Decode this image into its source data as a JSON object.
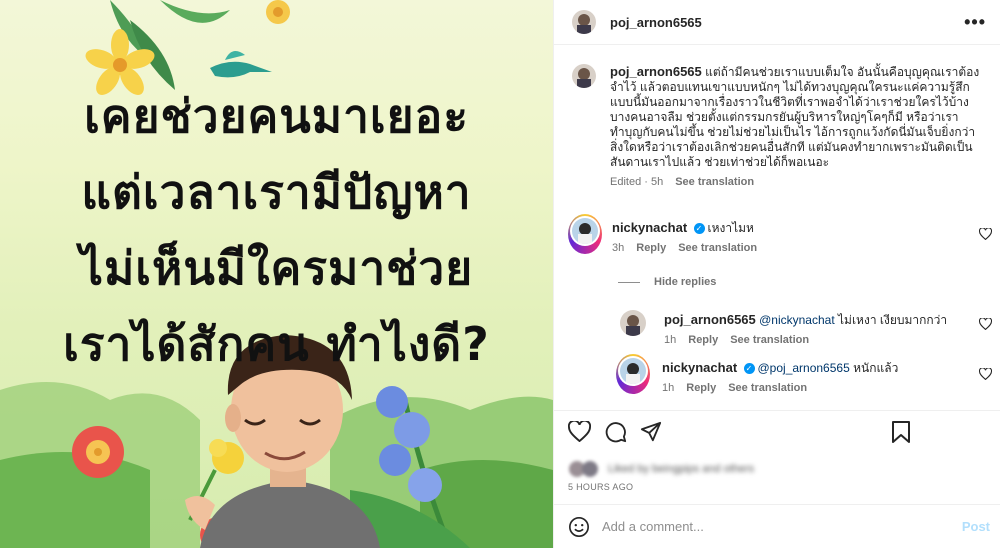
{
  "image": {
    "headline_lines": [
      "เคยช่วยคนมาเยอะ",
      "แต่เวลาเรามีปัญหา",
      "ไม่เห็นมีใครมาช่วย",
      "เราได้สักคน ทำไงดี?"
    ]
  },
  "header": {
    "username": "poj_arnon6565",
    "more_icon": "more-horizontal-icon"
  },
  "caption": {
    "username": "poj_arnon6565",
    "lines": [
      "แต่ถ้ามีคนช่วยเราแบบเต็มใจ อันนั้นคือบุญคุณเราต้อง",
      "จำไว้ แล้วตอบแทนเขาแบบหนักๆ ไม่ได้ทวงบุญคุณใครนะแค่ความรู้สึก",
      "แบบนี้มันออกมาจากเรื่องราวในชีวิตที่เราพอจำได้ว่าเราช่วยใครไว้บ้าง",
      "บางคนอาจลืม ช่วยตั้งแต่กรรมกรยันผู้บริหารใหญ่ๆโคๆก็มี หรือว่าเรา",
      "ทำบุญกับคนไม่ขึ้น ช่วยไม่ช่วยไม่เป็นไร ไอ้การถูกแว้งกัดนี่มันเจ็บยิ่งกว่า",
      "สิ่งใดหรือว่าเราต้องเลิกช่วยคนอื่นสักที แต่มันคงทำยากเพราะมันติดเป็น",
      "สันดานเราไปแล้ว ช่วยเท่าช่วยได้ก็พอเนอะ"
    ],
    "edited": "Edited · 5h",
    "see_translation": "See translation"
  },
  "comments": [
    {
      "username": "nickynachat",
      "text": "เหงาไมห",
      "time": "3h",
      "reply": "Reply",
      "see_translation": "See translation"
    }
  ],
  "hide_replies": "Hide replies",
  "replies": [
    {
      "username": "poj_arnon6565",
      "mention": "@nickynachat",
      "text": " ไม่เหงา เงียบมากกว่า",
      "time": "1h",
      "reply": "Reply",
      "see_translation": "See translation"
    },
    {
      "username": "nickynachat",
      "mention": "@poj_arnon6565",
      "text": " หนักแล้ว",
      "time": "1h",
      "reply": "Reply",
      "see_translation": "See translation"
    }
  ],
  "likes_text": "Liked by beingpips and others",
  "timestamp": "5 HOURS AGO",
  "add_comment": {
    "placeholder": "Add a comment...",
    "post_label": "Post"
  },
  "colors": {
    "link": "#00376b",
    "muted": "#737373",
    "post_disabled": "#b2dffc",
    "verified": "#0095f6"
  }
}
